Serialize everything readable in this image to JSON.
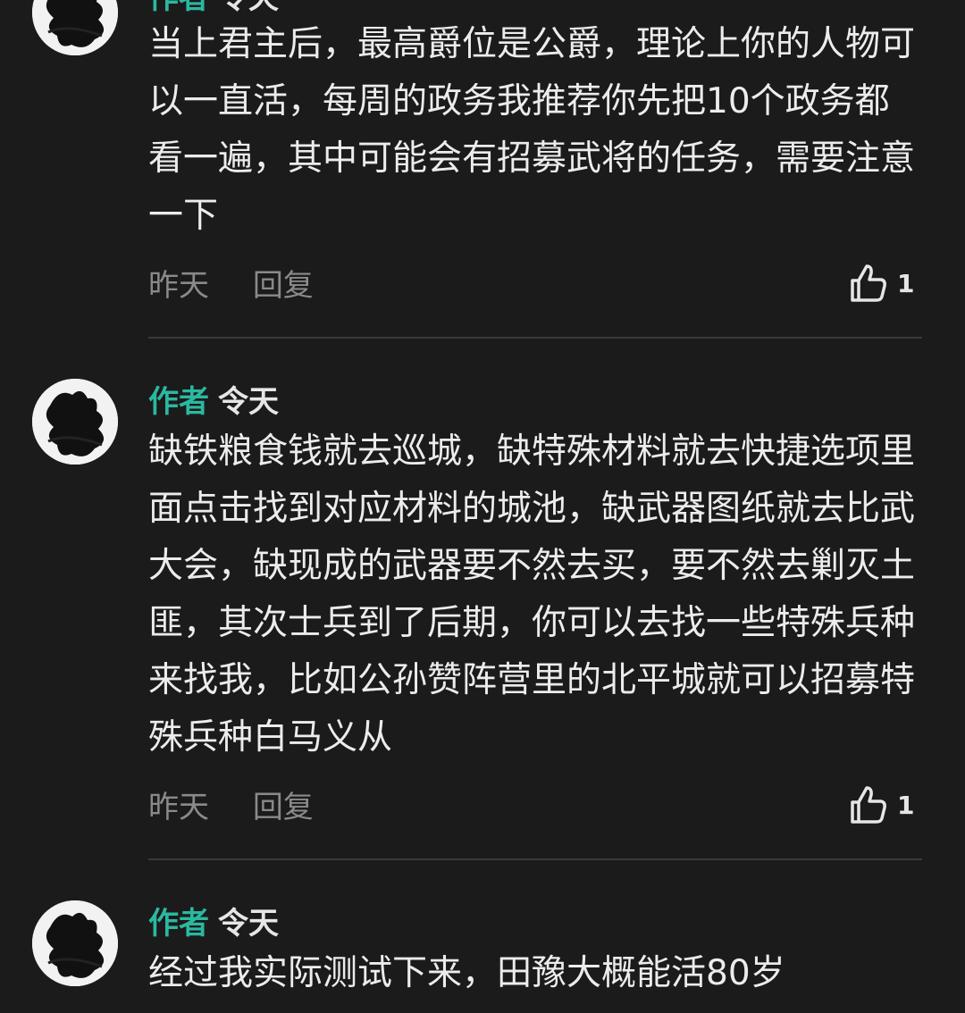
{
  "comments": [
    {
      "badge": "作者",
      "username": "令天",
      "text": "当上君主后，最高爵位是公爵，理论上你的人物可以一直活，每周的政务我推荐你先把10个政务都看一遍，其中可能会有招募武将的任务，需要注意一下",
      "time": "昨天",
      "reply_label": "回复",
      "likes": "1"
    },
    {
      "badge": "作者",
      "username": "令天",
      "text": "缺铁粮食钱就去巡城，缺特殊材料就去快捷选项里面点击找到对应材料的城池，缺武器图纸就去比武大会，缺现成的武器要不然去买，要不然去剿灭土匪，其次士兵到了后期，你可以去找一些特殊兵种来找我，比如公孙赞阵营里的北平城就可以招募特殊兵种白马义从",
      "time": "昨天",
      "reply_label": "回复",
      "likes": "1"
    },
    {
      "badge": "作者",
      "username": "令天",
      "text": "经过我实际测试下来，田豫大概能活80岁"
    }
  ],
  "colors": {
    "background": "#1b1b1b",
    "author_badge": "#2bb8a0",
    "meta": "#8a8a8a"
  }
}
